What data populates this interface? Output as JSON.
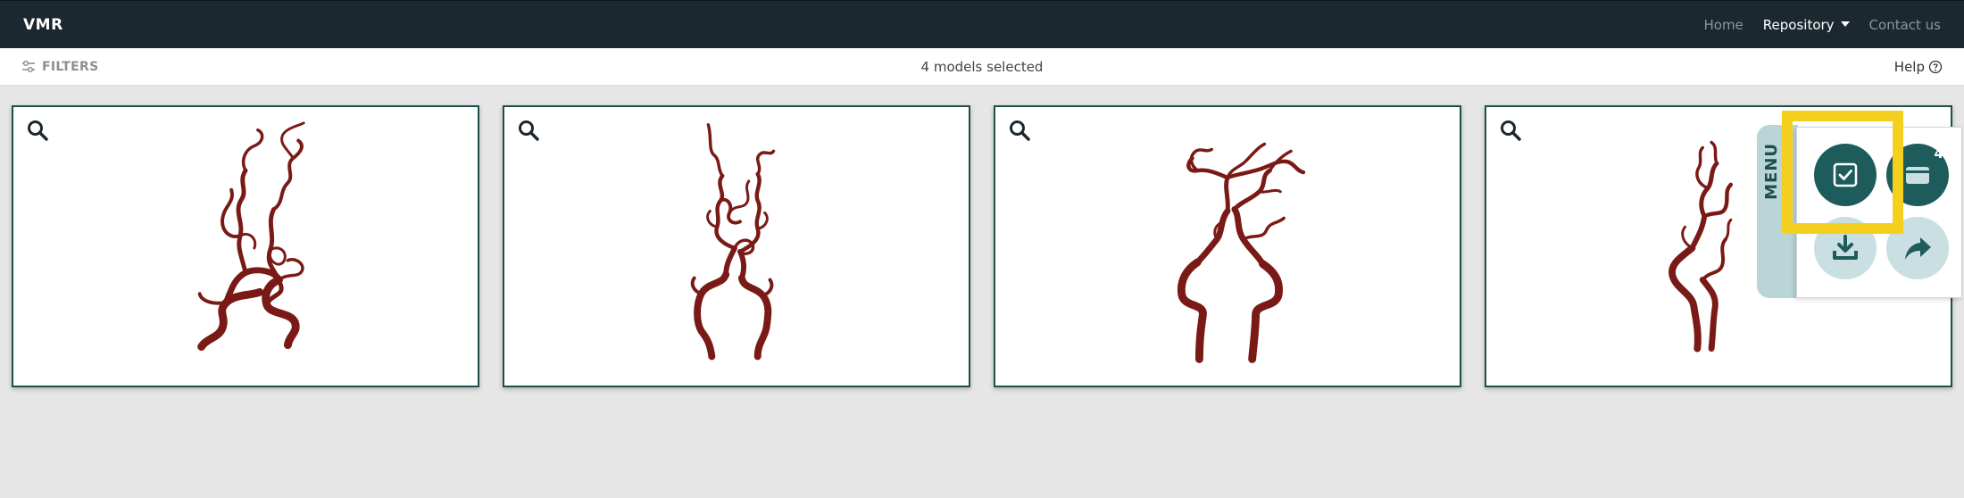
{
  "navbar": {
    "brand": "VMR",
    "links": [
      {
        "label": "Home"
      },
      {
        "label": "Repository"
      },
      {
        "label": "Contact us"
      }
    ]
  },
  "filterbar": {
    "filters_label": "FILTERS",
    "selection_text": "4 models selected",
    "help_label": "Help"
  },
  "cards": [
    {
      "zoom_icon": "search-icon"
    },
    {
      "zoom_icon": "search-icon"
    },
    {
      "zoom_icon": "search-icon"
    },
    {
      "zoom_icon": "search-icon"
    }
  ],
  "menu": {
    "tab_label": "MENU",
    "buttons": [
      {
        "name": "select-all",
        "icon": "checkbox-checked-icon"
      },
      {
        "name": "cart",
        "icon": "cart-icon",
        "badge": "4"
      },
      {
        "name": "download",
        "icon": "download-icon"
      },
      {
        "name": "share",
        "icon": "share-icon"
      }
    ]
  },
  "colors": {
    "navbar_bg": "#1c2830",
    "card_border": "#1e4f4a",
    "vessel": "#7a1a16",
    "menu_dark": "#1e5c5b",
    "menu_light": "#c9dfe1",
    "highlight": "#f5cf1e"
  }
}
